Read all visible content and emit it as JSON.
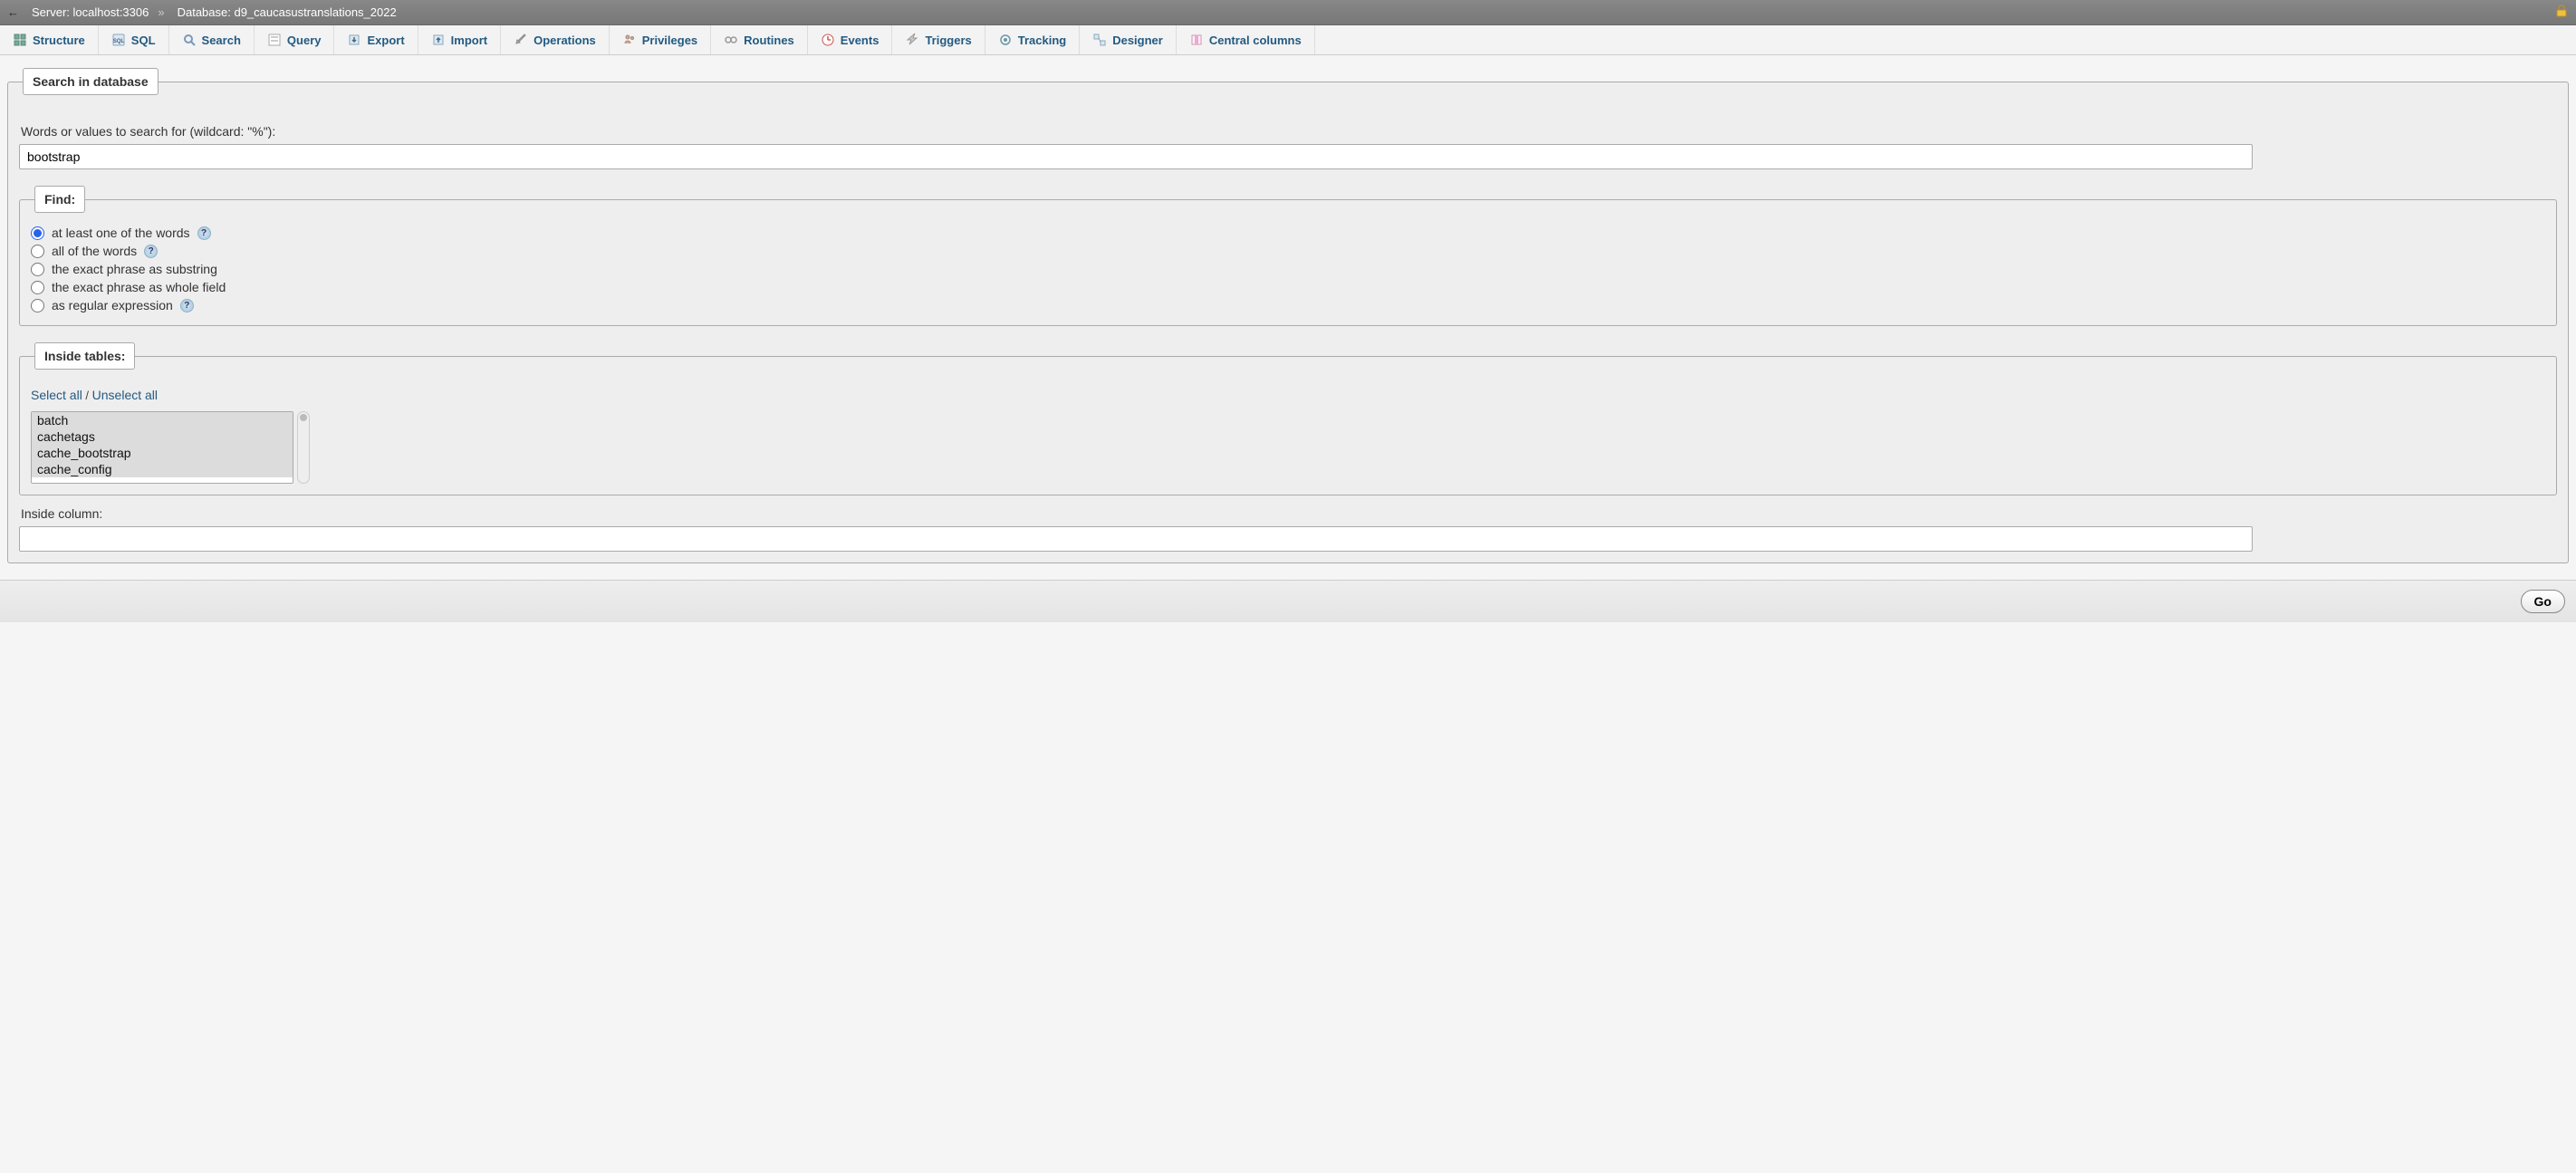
{
  "breadcrumb": {
    "server_label": "Server: localhost:3306",
    "database_label": "Database: d9_caucasustranslations_2022"
  },
  "tabs": [
    {
      "id": "structure",
      "label": "Structure"
    },
    {
      "id": "sql",
      "label": "SQL"
    },
    {
      "id": "search",
      "label": "Search"
    },
    {
      "id": "query",
      "label": "Query"
    },
    {
      "id": "export",
      "label": "Export"
    },
    {
      "id": "import",
      "label": "Import"
    },
    {
      "id": "operations",
      "label": "Operations"
    },
    {
      "id": "privileges",
      "label": "Privileges"
    },
    {
      "id": "routines",
      "label": "Routines"
    },
    {
      "id": "events",
      "label": "Events"
    },
    {
      "id": "triggers",
      "label": "Triggers"
    },
    {
      "id": "tracking",
      "label": "Tracking"
    },
    {
      "id": "designer",
      "label": "Designer"
    },
    {
      "id": "central_columns",
      "label": "Central columns"
    }
  ],
  "search": {
    "legend": "Search in database",
    "words_label": "Words or values to search for (wildcard: \"%\"):",
    "words_value": "bootstrap",
    "find": {
      "legend": "Find:",
      "options": [
        {
          "id": "at_least_one",
          "label": "at least one of the words",
          "checked": true,
          "help": true
        },
        {
          "id": "all_of",
          "label": "all of the words",
          "checked": false,
          "help": true
        },
        {
          "id": "exact_substring",
          "label": "the exact phrase as substring",
          "checked": false,
          "help": false
        },
        {
          "id": "exact_whole",
          "label": "the exact phrase as whole field",
          "checked": false,
          "help": false
        },
        {
          "id": "regex",
          "label": "as regular expression",
          "checked": false,
          "help": true
        }
      ]
    },
    "inside_tables": {
      "legend": "Inside tables:",
      "select_all": "Select all",
      "unselect_all": "Unselect all",
      "separator": " / ",
      "tables": [
        "batch",
        "cachetags",
        "cache_bootstrap",
        "cache_config"
      ]
    },
    "inside_column_label": "Inside column:",
    "inside_column_value": ""
  },
  "footer": {
    "go": "Go"
  }
}
